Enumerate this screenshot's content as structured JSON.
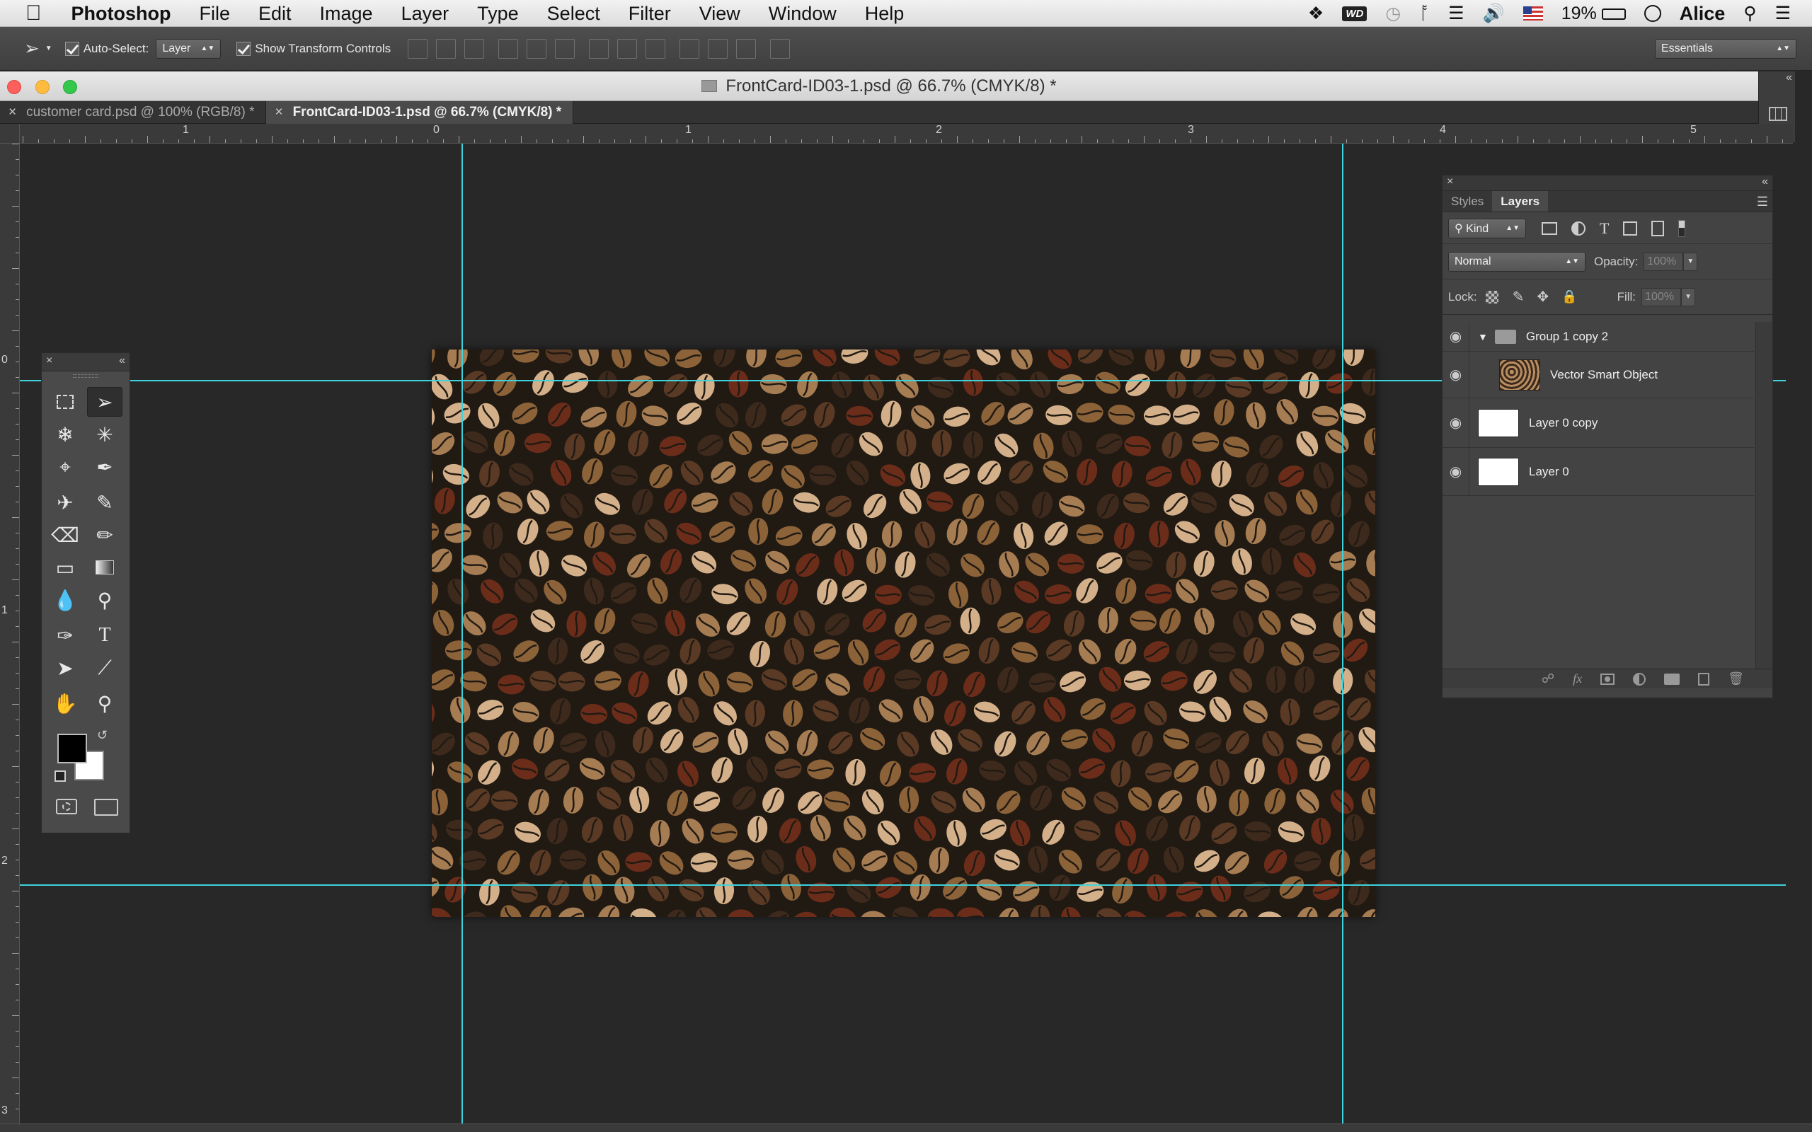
{
  "menubar": {
    "app": "Photoshop",
    "items": [
      "File",
      "Edit",
      "Image",
      "Layer",
      "Type",
      "Select",
      "Filter",
      "View",
      "Window",
      "Help"
    ],
    "status": {
      "wd": "WD",
      "battery": "19%",
      "user": "Alice"
    }
  },
  "options": {
    "auto_select_label": "Auto-Select:",
    "auto_select_value": "Layer",
    "transform_label": "Show Transform Controls",
    "workspace": "Essentials"
  },
  "window": {
    "title": "FrontCard-ID03-1.psd @ 66.7% (CMYK/8) *"
  },
  "tabs": [
    {
      "label": "customer card.psd @ 100% (RGB/8) *"
    },
    {
      "label": "FrontCard-ID03-1.psd @ 66.7% (CMYK/8) *"
    }
  ],
  "rulers": {
    "horizontal": [
      "1",
      "0",
      "1",
      "2",
      "3",
      "4",
      "5"
    ],
    "vertical": [
      "0",
      "1",
      "2",
      "3"
    ]
  },
  "layers_panel": {
    "tabs": [
      "Styles",
      "Layers"
    ],
    "filter_kind": "Kind",
    "blend_mode": "Normal",
    "opacity_label": "Opacity:",
    "opacity_value": "100%",
    "lock_label": "Lock:",
    "fill_label": "Fill:",
    "fill_value": "100%",
    "layers": [
      {
        "name": "Group 1 copy 2",
        "type": "group"
      },
      {
        "name": "Vector Smart Object",
        "type": "smart-object"
      },
      {
        "name": "Layer 0 copy",
        "type": "layer"
      },
      {
        "name": "Layer 0",
        "type": "layer"
      }
    ]
  },
  "colors": {
    "guide": "#3fd2dc",
    "artboard": "#211a13",
    "bean_palette": [
      "#d4b08a",
      "#8c6239",
      "#5a3a24",
      "#6b2d1a",
      "#3e2a1c",
      "#a67c52"
    ]
  }
}
